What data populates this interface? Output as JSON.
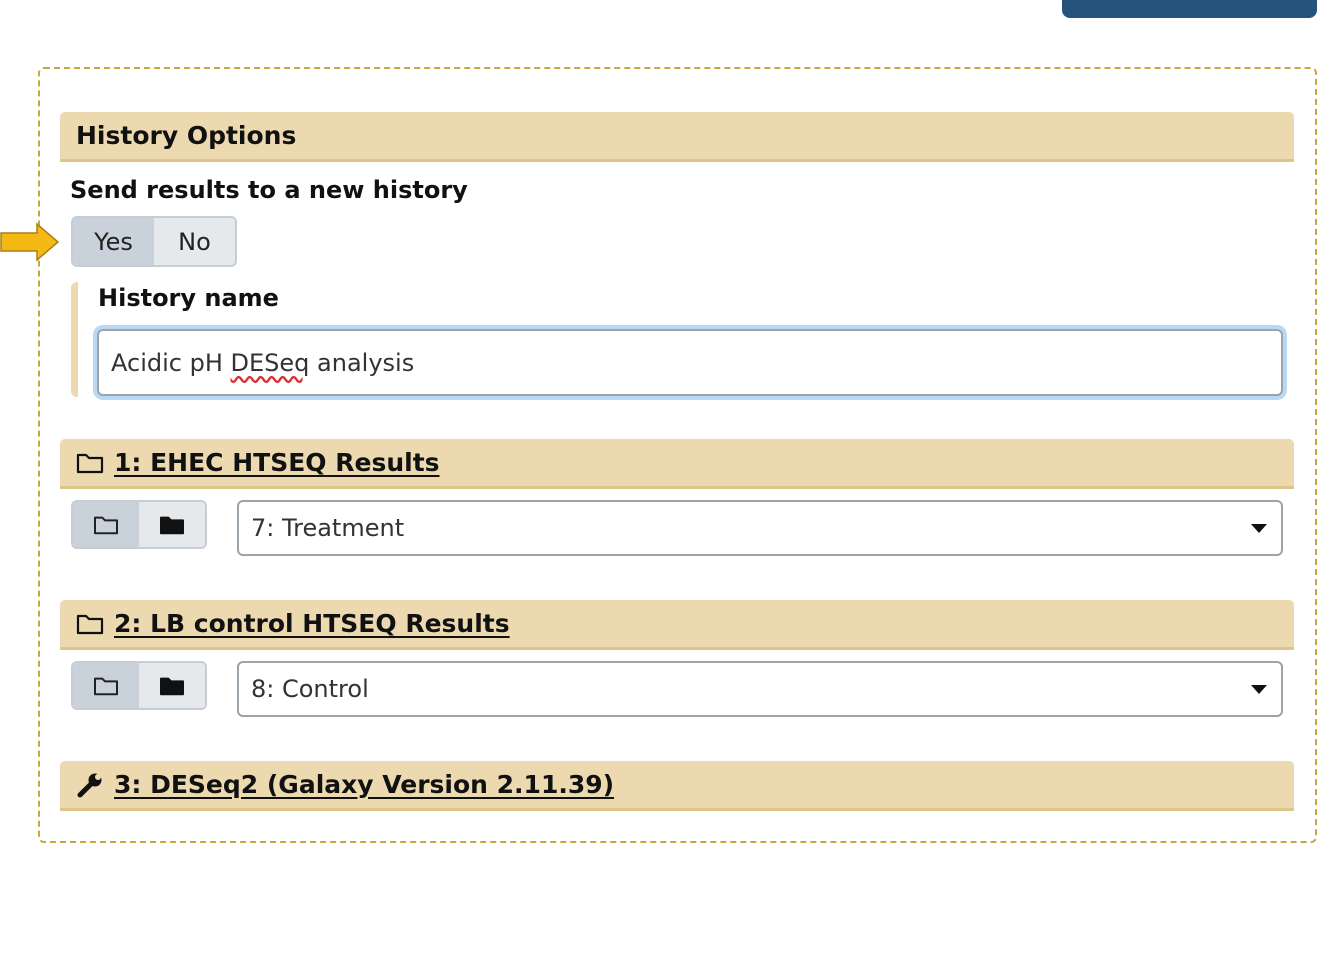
{
  "history_options": {
    "header": "History Options",
    "send_label": "Send results to a new history",
    "yes_label": "Yes",
    "no_label": "No",
    "selected": "Yes",
    "name_label": "History name",
    "name_value_part1": "Acidic pH ",
    "name_value_misspelled": "DESeq",
    "name_value_part2": " analysis"
  },
  "steps": [
    {
      "header": "1: EHEC HTSEQ Results",
      "icon": "folder-icon",
      "select_value": "7: Treatment"
    },
    {
      "header": "2: LB control HTSEQ Results",
      "icon": "folder-icon",
      "select_value": "8: Control"
    },
    {
      "header": "3: DESeq2 (Galaxy Version 2.11.39)",
      "icon": "wrench-icon"
    }
  ],
  "colors": {
    "section_header_bg": "#ecd9b0",
    "panel_border": "#c9a640",
    "arrow": "#f5b914",
    "top_button": "#25537b",
    "input_focus": "#b9d8f3"
  }
}
